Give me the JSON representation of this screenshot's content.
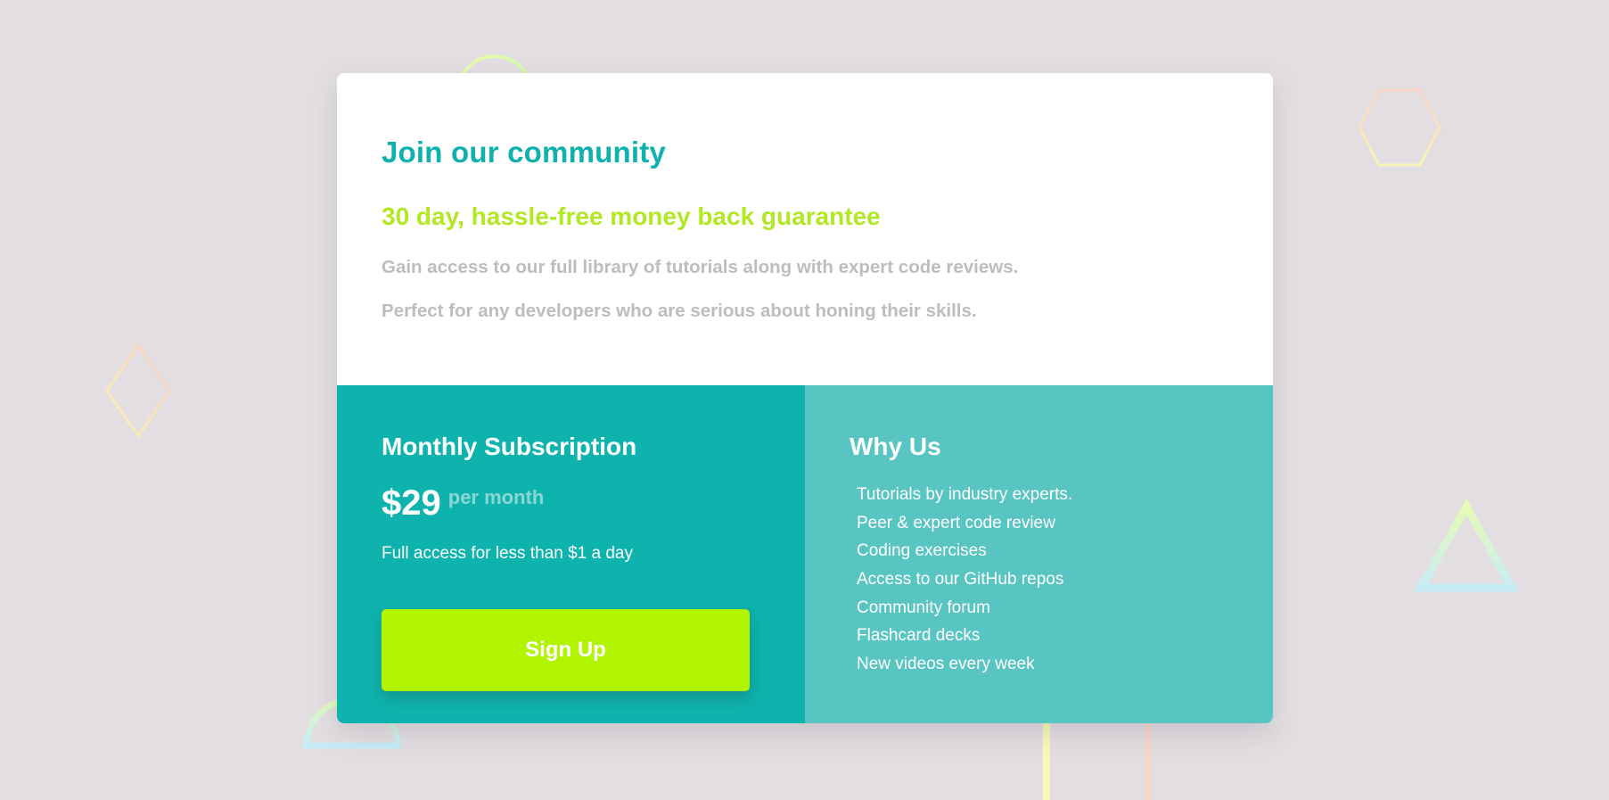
{
  "header": {
    "title": "Join our community",
    "subtitle": "30 day, hassle-free money back guarantee",
    "description_1": "Gain access to our full library of tutorials along with expert code reviews.",
    "description_2": "Perfect for any developers who are serious about honing their skills."
  },
  "subscription": {
    "title": "Monthly Subscription",
    "price": "$29",
    "price_unit": "per month",
    "note": "Full access for less than $1 a day",
    "signup_label": "Sign Up"
  },
  "why_us": {
    "title": "Why Us",
    "items": [
      "Tutorials by industry experts.",
      "Peer & expert code review",
      "Coding exercises",
      "Access to our GitHub repos",
      "Community forum",
      "Flashcard decks",
      "New videos every week"
    ]
  },
  "colors": {
    "background": "#e2dee1",
    "primary_teal": "#0fb3ae",
    "secondary_teal": "#58c5c2",
    "accent_lime": "#b1f400",
    "muted_text": "#bebcbe"
  },
  "decorations": [
    "circle-outline",
    "hexagon-outline",
    "diamond-outline",
    "triangle-outline",
    "half-circle-outline",
    "vertical-line",
    "vertical-line"
  ]
}
